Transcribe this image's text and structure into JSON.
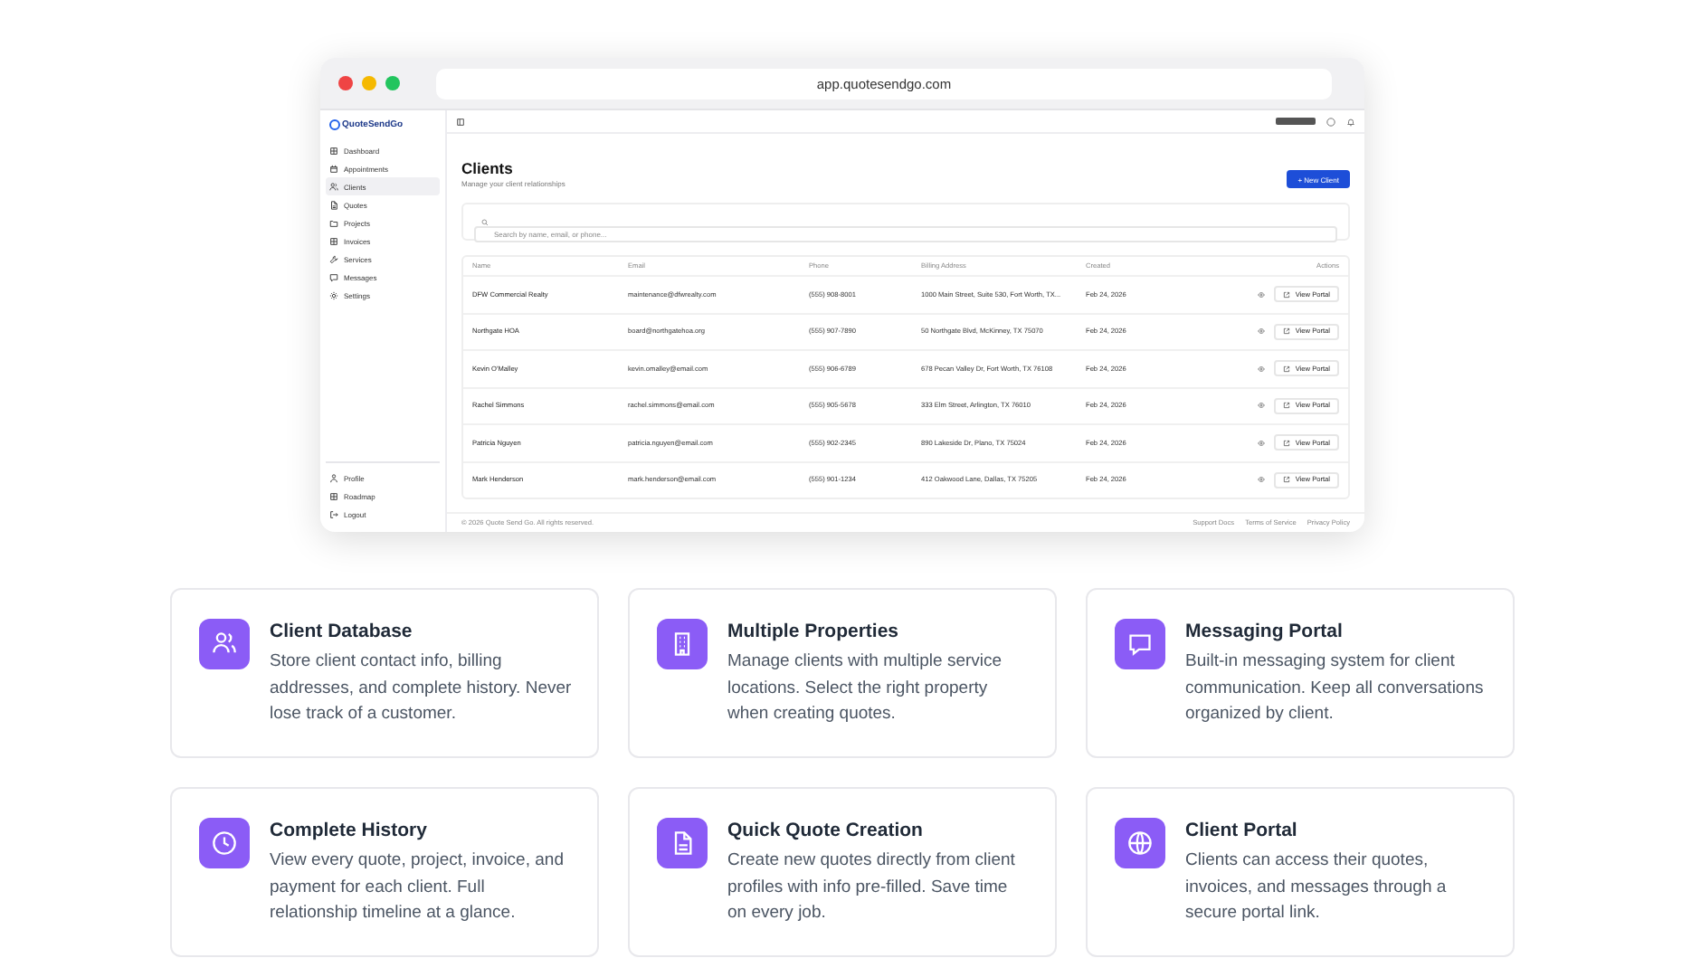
{
  "browser": {
    "url": "app.quotesendgo.com"
  },
  "app": {
    "logo": "QuoteSendGo",
    "sidebar": {
      "items": [
        {
          "label": "Dashboard",
          "kind": "grid",
          "selected": false
        },
        {
          "label": "Appointments",
          "kind": "calendar",
          "selected": false
        },
        {
          "label": "Clients",
          "kind": "users",
          "selected": true
        },
        {
          "label": "Quotes",
          "kind": "doc",
          "selected": false
        },
        {
          "label": "Projects",
          "kind": "folder",
          "selected": false
        },
        {
          "label": "Invoices",
          "kind": "grid",
          "selected": false
        },
        {
          "label": "Services",
          "kind": "wrench",
          "selected": false
        },
        {
          "label": "Messages",
          "kind": "chat",
          "selected": false
        },
        {
          "label": "Settings",
          "kind": "gear",
          "selected": false
        }
      ],
      "bottom_items": [
        {
          "label": "Profile",
          "kind": "user"
        },
        {
          "label": "Roadmap",
          "kind": "grid"
        },
        {
          "label": "Logout",
          "kind": "logout"
        }
      ]
    },
    "page_title": "Clients",
    "page_subtitle": "Manage your client relationships",
    "new_button": "+ New Client",
    "search": {
      "placeholder": "Search by name, email, or phone..."
    },
    "table": {
      "columns": [
        "Name",
        "Email",
        "Phone",
        "Billing Address",
        "Created",
        "Actions"
      ],
      "rows": [
        {
          "name": "DFW Commercial Realty",
          "email": "maintenance@dfwrealty.com",
          "phone": "(555) 908-8001",
          "address": "1000 Main Street, Suite 530, Fort Worth, TX...",
          "created": "Feb 24, 2026",
          "action": "View Portal"
        },
        {
          "name": "Northgate HOA",
          "email": "board@northgatehoa.org",
          "phone": "(555) 907-7890",
          "address": "50 Northgate Blvd, McKinney, TX 75070",
          "created": "Feb 24, 2026",
          "action": "View Portal"
        },
        {
          "name": "Kevin O'Malley",
          "email": "kevin.omalley@email.com",
          "phone": "(555) 906-6789",
          "address": "678 Pecan Valley Dr, Fort Worth, TX 76108",
          "created": "Feb 24, 2026",
          "action": "View Portal"
        },
        {
          "name": "Rachel Simmons",
          "email": "rachel.simmons@email.com",
          "phone": "(555) 905-5678",
          "address": "333 Elm Street, Arlington, TX 76010",
          "created": "Feb 24, 2026",
          "action": "View Portal"
        },
        {
          "name": "Patricia Nguyen",
          "email": "patricia.nguyen@email.com",
          "phone": "(555) 902-2345",
          "address": "890 Lakeside Dr, Plano, TX 75024",
          "created": "Feb 24, 2026",
          "action": "View Portal"
        },
        {
          "name": "Mark Henderson",
          "email": "mark.henderson@email.com",
          "phone": "(555) 901-1234",
          "address": "412 Oakwood Lane, Dallas, TX 75205",
          "created": "Feb 24, 2026",
          "action": "View Portal"
        }
      ]
    },
    "footer": {
      "copyright": "© 2026 Quote Send Go. All rights reserved.",
      "links": [
        "Support Docs",
        "Terms of Service",
        "Privacy Policy"
      ]
    }
  },
  "features": [
    {
      "kind": "users",
      "title": "Client Database",
      "text": "Store client contact info, billing addresses, and complete history. Never lose track of a customer."
    },
    {
      "kind": "building",
      "title": "Multiple Properties",
      "text": "Manage clients with multiple service locations. Select the right property when creating quotes."
    },
    {
      "kind": "chat",
      "title": "Messaging Portal",
      "text": "Built-in messaging system for client communication. Keep all conversations organized by client."
    },
    {
      "kind": "clock",
      "title": "Complete History",
      "text": "View every quote, project, invoice, and payment for each client. Full relationship timeline at a glance."
    },
    {
      "kind": "doc",
      "title": "Quick Quote Creation",
      "text": "Create new quotes directly from client profiles with info pre-filled. Save time on every job."
    },
    {
      "kind": "globe",
      "title": "Client Portal",
      "text": "Clients can access their quotes, invoices, and messages through a secure portal link."
    }
  ]
}
